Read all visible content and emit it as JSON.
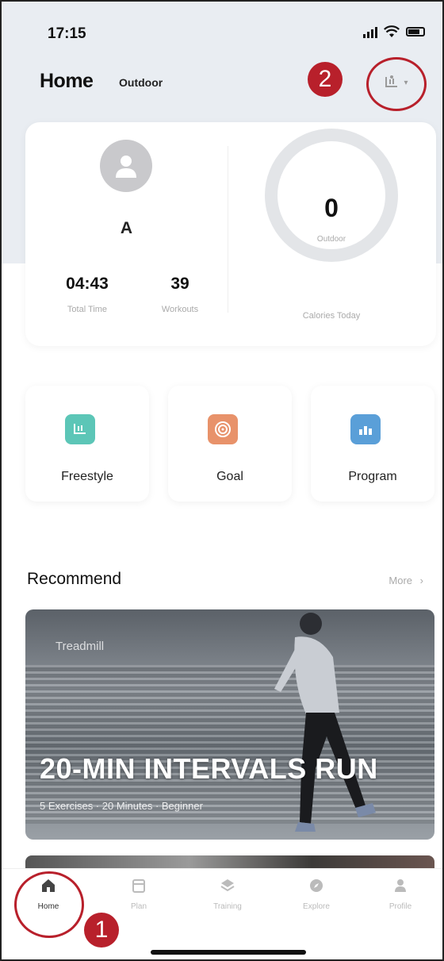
{
  "status_bar": {
    "time": "17:15"
  },
  "header": {
    "title": "Home",
    "subtitle": "Outdoor",
    "device_icon": "treadmill-icon"
  },
  "annotations": {
    "badge_1": "1",
    "badge_2": "2"
  },
  "summary": {
    "user_name": "A",
    "total_time_value": "04:43",
    "total_time_label": "Total Time",
    "workouts_value": "39",
    "workouts_label": "Workouts",
    "calories_value": "0",
    "calories_ring_sub": "Outdoor",
    "calories_label": "Calories Today"
  },
  "modes": [
    {
      "label": "Freestyle",
      "icon": "freestyle-icon",
      "color": "#5cc6b7"
    },
    {
      "label": "Goal",
      "icon": "target-icon",
      "color": "#e8926a"
    },
    {
      "label": "Program",
      "icon": "chart-icon",
      "color": "#5a9fd8"
    }
  ],
  "recommend": {
    "title": "Recommend",
    "more": "More",
    "banner": {
      "tag": "Treadmill",
      "title": "20-MIN INTERVALS RUN",
      "meta": "5 Exercises · 20 Minutes · Beginner"
    }
  },
  "tabs": [
    {
      "label": "Home",
      "icon": "home-icon",
      "active": true
    },
    {
      "label": "Plan",
      "icon": "calendar-icon",
      "active": false
    },
    {
      "label": "Training",
      "icon": "layers-icon",
      "active": false
    },
    {
      "label": "Explore",
      "icon": "compass-icon",
      "active": false
    },
    {
      "label": "Profile",
      "icon": "person-icon",
      "active": false
    }
  ],
  "colors": {
    "accent": "#b8202b",
    "ring": "#e3e5e8",
    "background_top": "#e9edf2"
  }
}
